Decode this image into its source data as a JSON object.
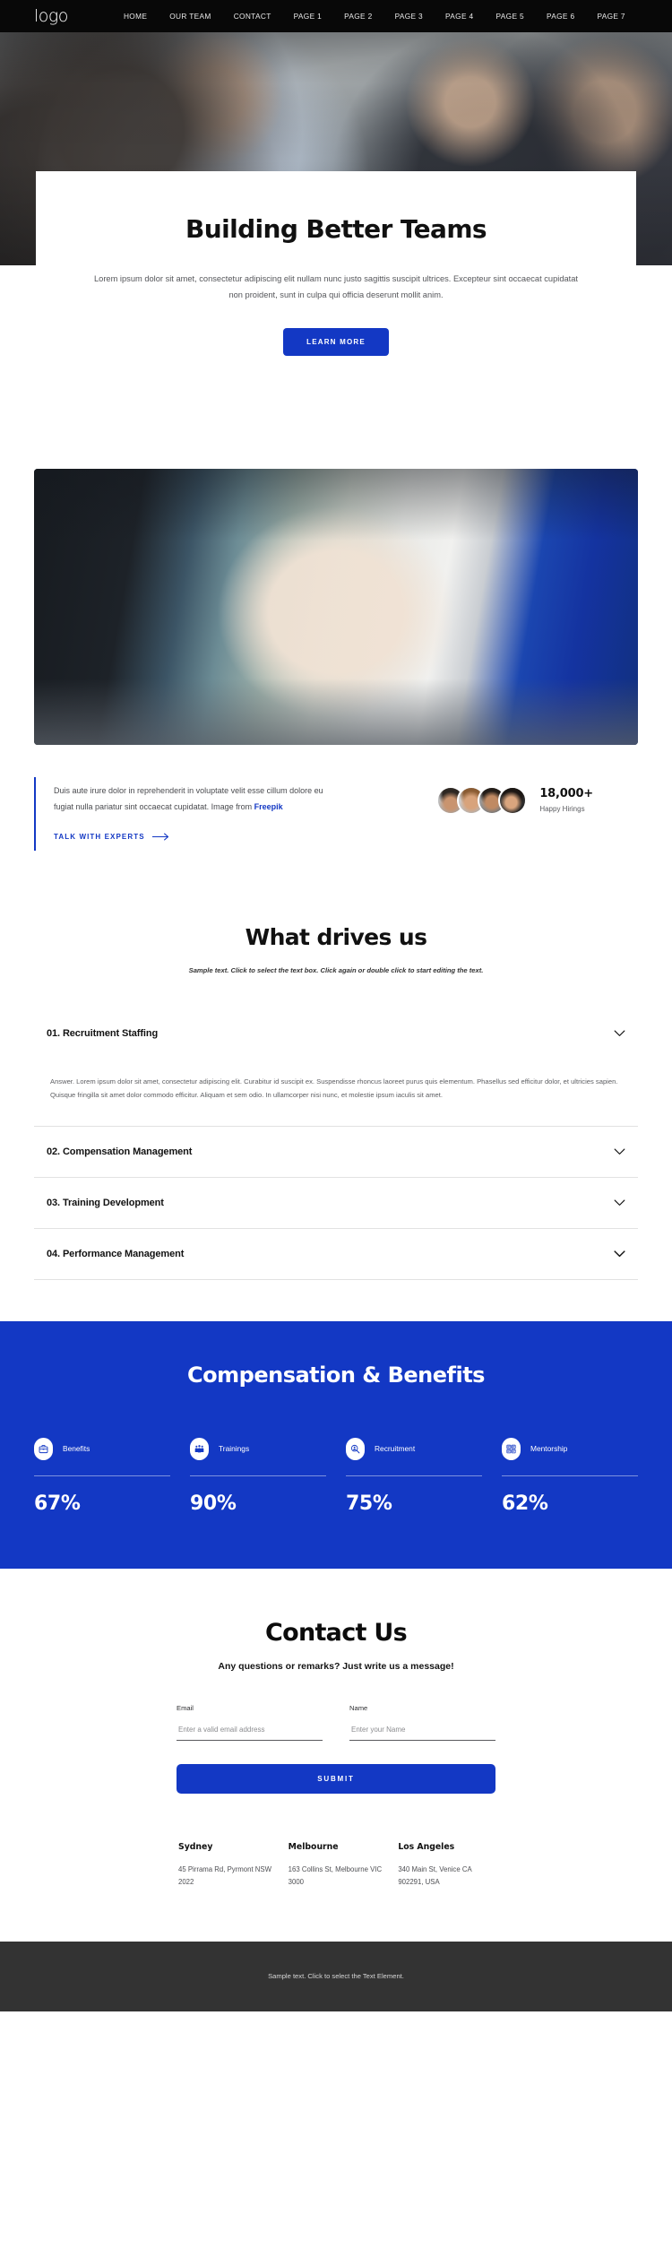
{
  "nav": {
    "logo": "logo",
    "links": [
      {
        "label": "HOME"
      },
      {
        "label": "OUR TEAM"
      },
      {
        "label": "CONTACT"
      },
      {
        "label": "PAGE 1"
      },
      {
        "label": "PAGE 2"
      },
      {
        "label": "PAGE 3"
      },
      {
        "label": "PAGE 4"
      },
      {
        "label": "PAGE 5"
      },
      {
        "label": "PAGE 6"
      },
      {
        "label": "PAGE 7"
      }
    ]
  },
  "hero": {
    "title": "Building Better Teams",
    "paragraph": "Lorem ipsum dolor sit amet, consectetur adipiscing elit nullam nunc justo sagittis suscipit ultrices. Excepteur sint occaecat cupidatat non proident, sunt in culpa qui officia deserunt mollit anim.",
    "cta": "LEARN MORE"
  },
  "quote": {
    "text_before": "Duis aute irure dolor in reprehenderit in voluptate velit esse cillum dolore eu fugiat nulla pariatur sint occaecat cupidatat. Image from ",
    "brand": "Freepik",
    "link": "TALK WITH EXPERTS",
    "stat_value": "18,000+",
    "stat_label": "Happy Hirings"
  },
  "drives": {
    "title": "What drives us",
    "subtitle": "Sample text. Click to select the text box. Click again or double click to start editing the text.",
    "items": [
      {
        "title": "01. Recruitment Staffing",
        "open": true,
        "body": "Answer. Lorem ipsum dolor sit amet, consectetur adipiscing elit. Curabitur id suscipit ex. Suspendisse rhoncus laoreet purus quis elementum. Phasellus sed efficitur dolor, et ultricies sapien. Quisque fringilla sit amet dolor commodo efficitur. Aliquam et sem odio. In ullamcorper nisi nunc, et molestie ipsum iaculis sit amet."
      },
      {
        "title": "02. Compensation Management",
        "open": false,
        "body": ""
      },
      {
        "title": "03. Training Development",
        "open": false,
        "body": ""
      },
      {
        "title": "04. Performance Management",
        "open": false,
        "body": ""
      }
    ]
  },
  "benefits": {
    "title": "Compensation & Benefits",
    "accent": "#1338C4",
    "metrics": [
      {
        "name": "Benefits",
        "value": "67%",
        "icon": "briefcase-icon"
      },
      {
        "name": "Trainings",
        "value": "90%",
        "icon": "group-people-icon"
      },
      {
        "name": "Recruitment",
        "value": "75%",
        "icon": "magnifier-person-icon"
      },
      {
        "name": "Mentorship",
        "value": "62%",
        "icon": "id-cards-icon"
      }
    ]
  },
  "chart_data": {
    "type": "bar",
    "title": "Compensation & Benefits",
    "categories": [
      "Benefits",
      "Trainings",
      "Recruitment",
      "Mentorship"
    ],
    "values": [
      67,
      90,
      75,
      62
    ],
    "unit": "%",
    "xlabel": "",
    "ylabel": "",
    "ylim": [
      0,
      100
    ],
    "grid": false,
    "legend": "none"
  },
  "contact": {
    "title": "Contact Us",
    "tagline": "Any questions or remarks? Just write us a message!",
    "email_label": "Email",
    "email_placeholder": "Enter a valid email address",
    "email_value": "",
    "name_label": "Name",
    "name_placeholder": "Enter your Name",
    "name_value": "",
    "submit": "SUBMIT"
  },
  "offices": [
    {
      "city": "Sydney",
      "address": "45 Pirrama Rd, Pyrmont NSW 2022"
    },
    {
      "city": "Melbourne",
      "address": "163 Collins St, Melbourne VIC 3000"
    },
    {
      "city": "Los Angeles",
      "address": "340 Main St, Venice CA 902291, USA"
    }
  ],
  "footer": {
    "text": "Sample text. Click to select the Text Element."
  }
}
